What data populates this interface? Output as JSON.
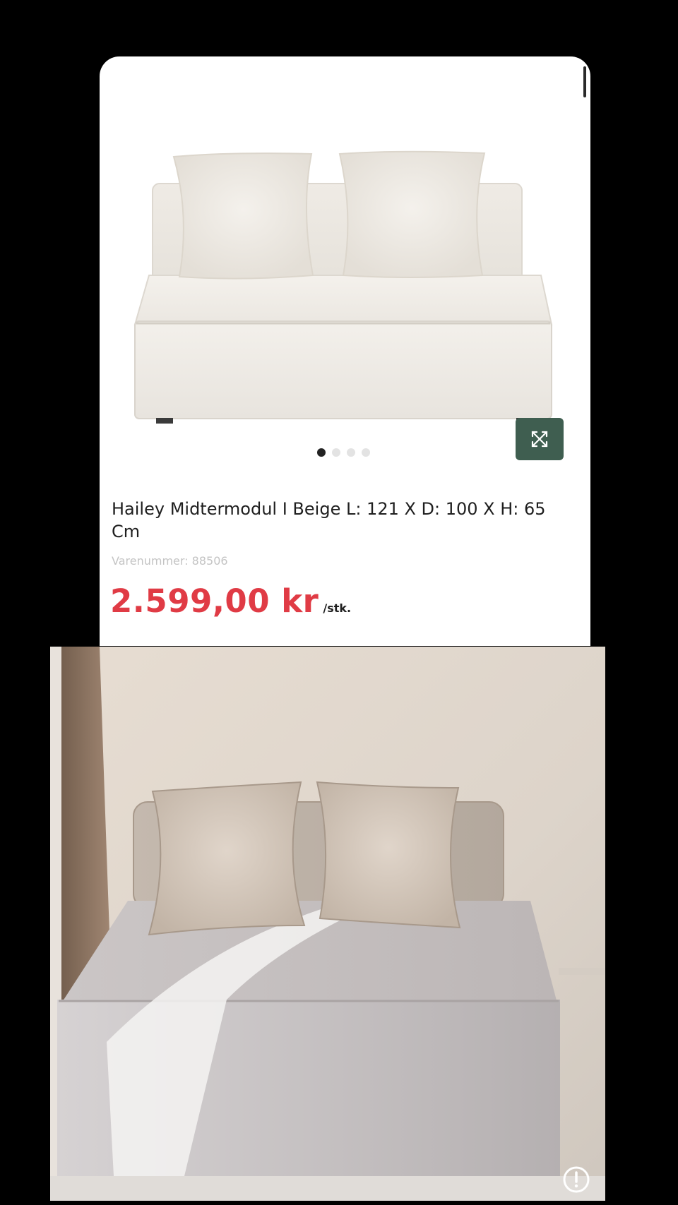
{
  "product": {
    "title": "Hailey Midtermodul I Beige L: 121 X D: 100 X H: 65 Cm",
    "sku": "Varenummer: 88506",
    "price": "2.599,00 kr",
    "price_unit": "/stk."
  },
  "carousel": {
    "total_slides": 4,
    "active_index": 0
  },
  "icons": {
    "expand": "expand-arrows-icon",
    "info": "info-icon"
  },
  "colors": {
    "price": "#e03b45",
    "expand_button": "#3f5e50",
    "background": "#000000",
    "card": "#ffffff"
  }
}
